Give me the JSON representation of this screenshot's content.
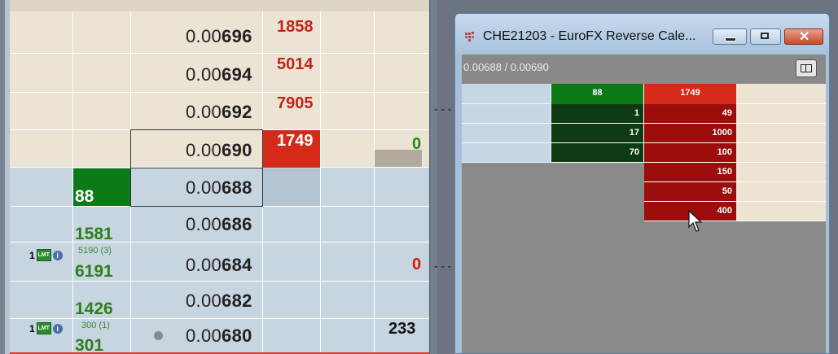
{
  "ladder": {
    "rows": [
      {
        "price_prefix": "0.00",
        "price_suffix": "696",
        "ask_qty": "1858",
        "side": "ask"
      },
      {
        "price_prefix": "0.00",
        "price_suffix": "694",
        "ask_qty": "5014",
        "side": "ask"
      },
      {
        "price_prefix": "0.00",
        "price_suffix": "692",
        "ask_qty": "7905",
        "side": "ask"
      },
      {
        "price_prefix": "0.00",
        "price_suffix": "690",
        "ask_qty": "1749",
        "side": "ask",
        "pnl": "0"
      },
      {
        "price_prefix": "0.00",
        "price_suffix": "688",
        "bid_qty": "88",
        "side": "bid"
      },
      {
        "price_prefix": "0.00",
        "price_suffix": "686",
        "bid_qty": "1581",
        "side": "bid"
      },
      {
        "price_prefix": "0.00",
        "price_suffix": "684",
        "bid_qty": "6191",
        "side": "bid",
        "order_count": "1",
        "small": "5190 (3)",
        "pnl": "0"
      },
      {
        "price_prefix": "0.00",
        "price_suffix": "682",
        "bid_qty": "1426",
        "side": "bid"
      },
      {
        "price_prefix": "0.00",
        "price_suffix": "680",
        "bid_qty": "301",
        "side": "bid",
        "order_count": "1",
        "small": "300 (1)",
        "pnl": "233"
      }
    ],
    "lmt_label": "LMT",
    "info_glyph": "i",
    "colors": {
      "ask_bg": "#ebe3d3",
      "bid_bg": "#c7d5e1",
      "ask_text": "#c8201a",
      "bid_text": "#2d7f1e",
      "best_ask": "#d52a19",
      "best_bid": "#0d7a18"
    }
  },
  "popup": {
    "title": "CHE21203 - EuroFX Reverse Cale...",
    "bid_ask": "0.00688 / 0.00690",
    "header_bid": "88",
    "header_ask": "1749",
    "bid_rows": [
      "1",
      "17",
      "70"
    ],
    "ask_rows": [
      "49",
      "1000",
      "100",
      "150",
      "50",
      "400"
    ],
    "buttons": {
      "minimize": "minimize",
      "maximize": "maximize",
      "close": "close"
    }
  },
  "background": {
    "dashes": [
      "---",
      "---"
    ]
  }
}
